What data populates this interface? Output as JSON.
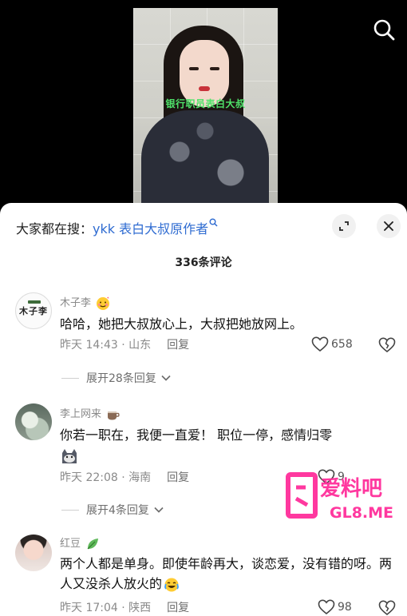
{
  "video": {
    "caption": "银行职员表白大叔"
  },
  "header": {
    "search_prefix": "大家都在搜：",
    "search_keyword": "ykk 表白大叔原作者",
    "comment_count": "336条评论"
  },
  "comments": [
    {
      "username": "木子李",
      "avatar_text": "木子李",
      "text": "哈哈，她把大叔放心上，大叔把她放网上。",
      "time": "昨天 14:43",
      "location": "山东",
      "reply_label": "回复",
      "likes": "658",
      "expand_label": "展开28条回复"
    },
    {
      "username": "李上网来",
      "text": "你若一职在，我便一直爱！ 职位一停，感情归零",
      "time": "昨天 22:08",
      "location": "海南",
      "reply_label": "回复",
      "likes": "9",
      "expand_label": "展开4条回复"
    },
    {
      "username": "红豆",
      "text": "两个人都是单身。即使年龄再大，谈恋爱，没有错的呀。两人又没杀人放火的",
      "time": "昨天 17:04",
      "location": "陕西",
      "reply_label": "回复",
      "likes": "98"
    }
  ],
  "watermark": {
    "text_top": "爱料吧",
    "text_bottom": "GL8.ME"
  },
  "colors": {
    "accent_link": "#2e6bd1",
    "watermark": "#ff2e9a"
  }
}
